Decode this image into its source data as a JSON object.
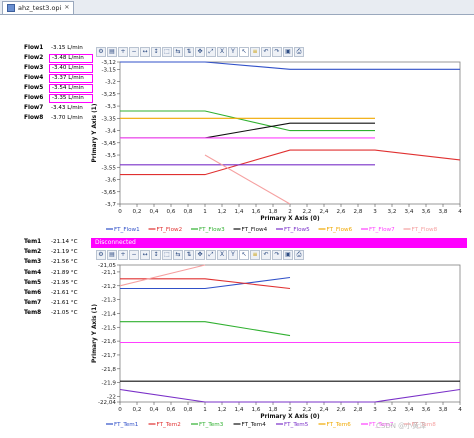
{
  "window": {
    "tab_title": "ahz_test3.opi"
  },
  "flows": [
    {
      "label": "Flow1",
      "value": "-3.15 L/min",
      "highlight": false
    },
    {
      "label": "Flow2",
      "value": "-3.48 L/min",
      "highlight": true
    },
    {
      "label": "Flow3",
      "value": "-3.40 L/min",
      "highlight": true
    },
    {
      "label": "Flow4",
      "value": "-3.37 L/min",
      "highlight": true
    },
    {
      "label": "Flow5",
      "value": "-3.54 L/min",
      "highlight": true
    },
    {
      "label": "Flow6",
      "value": "-3.35 L/min",
      "highlight": true
    },
    {
      "label": "Flow7",
      "value": "-3.43 L/min",
      "highlight": false
    },
    {
      "label": "Flow8",
      "value": "-3.70 L/min",
      "highlight": false
    }
  ],
  "temps": [
    {
      "label": "Tem1",
      "value": "-21.14 °C"
    },
    {
      "label": "Tem2",
      "value": "-21.19 °C"
    },
    {
      "label": "Tem3",
      "value": "-21.56 °C"
    },
    {
      "label": "Tem4",
      "value": "-21.89 °C"
    },
    {
      "label": "Tem5",
      "value": "-21.95 °C"
    },
    {
      "label": "Tem6",
      "value": "-21.61 °C"
    },
    {
      "label": "Tem7",
      "value": "-21.61 °C"
    },
    {
      "label": "Tem8",
      "value": "-21.05 °C"
    }
  ],
  "toolbar_icons": [
    "config-icon",
    "legend-icon",
    "zoom-in-icon",
    "zoom-out-icon",
    "horizontal-zoom-icon",
    "vertical-zoom-icon",
    "rubberband-zoom-icon",
    "horizontal-zoom-out-icon",
    "vertical-zoom-out-icon",
    "panning-icon",
    "zoom-to-fit-icon",
    "x-zoom-icon",
    "y-zoom-icon",
    "pointer-icon",
    "stack-icon",
    "undo-icon",
    "redo-icon",
    "save-snapshot-icon",
    "print-icon"
  ],
  "disconnected_label": "Disconnected",
  "watermark": "CSDN @小黄泽",
  "chart_data": [
    {
      "type": "line",
      "ylabel": "Primary Y Axis (1)",
      "xlabel": "Primary X Axis (0)",
      "ylim": [
        -3.7,
        -3.12
      ],
      "xlim": [
        0,
        4
      ],
      "yticks": [
        "-3,12",
        "-3,15",
        "-3,2",
        "-3,25",
        "-3,3",
        "-3,35",
        "-3,4",
        "-3,45",
        "-3,5",
        "-3,55",
        "-3,6",
        "-3,65",
        "-3,7"
      ],
      "ytick_values": [
        -3.12,
        -3.15,
        -3.2,
        -3.25,
        -3.3,
        -3.35,
        -3.4,
        -3.45,
        -3.5,
        -3.55,
        -3.6,
        -3.65,
        -3.7
      ],
      "xticks": [
        "0",
        "0,2",
        "0,4",
        "0,6",
        "0,8",
        "1",
        "1,2",
        "1,4",
        "1,6",
        "1,8",
        "2",
        "2,2",
        "2,4",
        "2,6",
        "2,8",
        "3",
        "3,2",
        "3,4",
        "3,6",
        "3,8",
        "4"
      ],
      "xtick_values": [
        0,
        0.2,
        0.4,
        0.6,
        0.8,
        1,
        1.2,
        1.4,
        1.6,
        1.8,
        2,
        2.2,
        2.4,
        2.6,
        2.8,
        3,
        3.2,
        3.4,
        3.6,
        3.8,
        4
      ],
      "series": [
        {
          "name": "FT_Flow1",
          "color": "#3050c8",
          "x": [
            0,
            1,
            2,
            3,
            4
          ],
          "y": [
            -3.12,
            -3.12,
            -3.15,
            -3.15,
            -3.15
          ]
        },
        {
          "name": "FT_Flow2",
          "color": "#e03030",
          "x": [
            0,
            1,
            2,
            3,
            4
          ],
          "y": [
            -3.58,
            -3.58,
            -3.48,
            -3.48,
            -3.52
          ]
        },
        {
          "name": "FT_Flow3",
          "color": "#30b030",
          "x": [
            0,
            1,
            2,
            3
          ],
          "y": [
            -3.32,
            -3.32,
            -3.4,
            -3.4
          ]
        },
        {
          "name": "FT_Flow4",
          "color": "#111111",
          "x": [
            0,
            1,
            2,
            3
          ],
          "y": [
            -3.43,
            -3.43,
            -3.37,
            -3.37
          ]
        },
        {
          "name": "FT_Flow5",
          "color": "#7a30c8",
          "x": [
            0,
            1,
            2,
            3
          ],
          "y": [
            -3.54,
            -3.54,
            -3.54,
            -3.54
          ]
        },
        {
          "name": "FT_Flow6",
          "color": "#f0a800",
          "x": [
            0,
            1,
            2,
            3
          ],
          "y": [
            -3.35,
            -3.35,
            -3.35,
            -3.35
          ]
        },
        {
          "name": "FT_Flow7",
          "color": "#ff40ff",
          "x": [
            0,
            1,
            2,
            3
          ],
          "y": [
            -3.43,
            -3.43,
            -3.43,
            -3.43
          ]
        },
        {
          "name": "FT_Flow8",
          "color": "#f5a0a0",
          "x": [
            1,
            2
          ],
          "y": [
            -3.5,
            -3.7
          ]
        }
      ]
    },
    {
      "type": "line",
      "ylabel": "Primary Y Axis (1)",
      "xlabel": "Primary X Axis (0)",
      "ylim": [
        -22.04,
        -21.05
      ],
      "xlim": [
        0,
        4
      ],
      "yticks": [
        "-21,05",
        "-21,1",
        "-21,2",
        "-21,3",
        "-21,4",
        "-21,5",
        "-21,6",
        "-21,7",
        "-21,8",
        "-21,9",
        "-22",
        "-22,04"
      ],
      "ytick_values": [
        -21.05,
        -21.1,
        -21.2,
        -21.3,
        -21.4,
        -21.5,
        -21.6,
        -21.7,
        -21.8,
        -21.9,
        -22.0,
        -22.04
      ],
      "xticks": [
        "0",
        "0,2",
        "0,4",
        "0,6",
        "0,8",
        "1",
        "1,2",
        "1,4",
        "1,6",
        "1,8",
        "2",
        "2,2",
        "2,4",
        "2,6",
        "2,8",
        "3",
        "3,2",
        "3,4",
        "3,6",
        "3,8",
        "4"
      ],
      "xtick_values": [
        0,
        0.2,
        0.4,
        0.6,
        0.8,
        1,
        1.2,
        1.4,
        1.6,
        1.8,
        2,
        2.2,
        2.4,
        2.6,
        2.8,
        3,
        3.2,
        3.4,
        3.6,
        3.8,
        4
      ],
      "series": [
        {
          "name": "FT_Tem1",
          "color": "#3050c8",
          "x": [
            0,
            1,
            2
          ],
          "y": [
            -21.22,
            -21.22,
            -21.14
          ]
        },
        {
          "name": "FT_Tem2",
          "color": "#e03030",
          "x": [
            0,
            1,
            2
          ],
          "y": [
            -21.15,
            -21.15,
            -21.22
          ]
        },
        {
          "name": "FT_Tem3",
          "color": "#30b030",
          "x": [
            0,
            1,
            2
          ],
          "y": [
            -21.46,
            -21.46,
            -21.56
          ]
        },
        {
          "name": "FT_Tem4",
          "color": "#111111",
          "x": [
            0,
            1,
            2,
            3,
            4
          ],
          "y": [
            -21.89,
            -21.89,
            -21.89,
            -21.89,
            -21.89
          ]
        },
        {
          "name": "FT_Tem5",
          "color": "#7a30c8",
          "x": [
            0,
            1,
            2,
            3,
            4
          ],
          "y": [
            -21.95,
            -22.04,
            -22.04,
            -22.04,
            -21.95
          ]
        },
        {
          "name": "FT_Tem6",
          "color": "#f0a800",
          "x": [
            0,
            1,
            2,
            3,
            4
          ],
          "y": [
            -21.61,
            -21.61,
            -21.61,
            -21.61,
            -21.61
          ]
        },
        {
          "name": "FT_Tem7",
          "color": "#ff40ff",
          "x": [
            0,
            1,
            2,
            3,
            4
          ],
          "y": [
            -21.61,
            -21.61,
            -21.61,
            -21.61,
            -21.61
          ]
        },
        {
          "name": "FT_Tem8",
          "color": "#f5a0a0",
          "x": [
            0,
            1
          ],
          "y": [
            -21.2,
            -21.05
          ]
        }
      ]
    }
  ]
}
